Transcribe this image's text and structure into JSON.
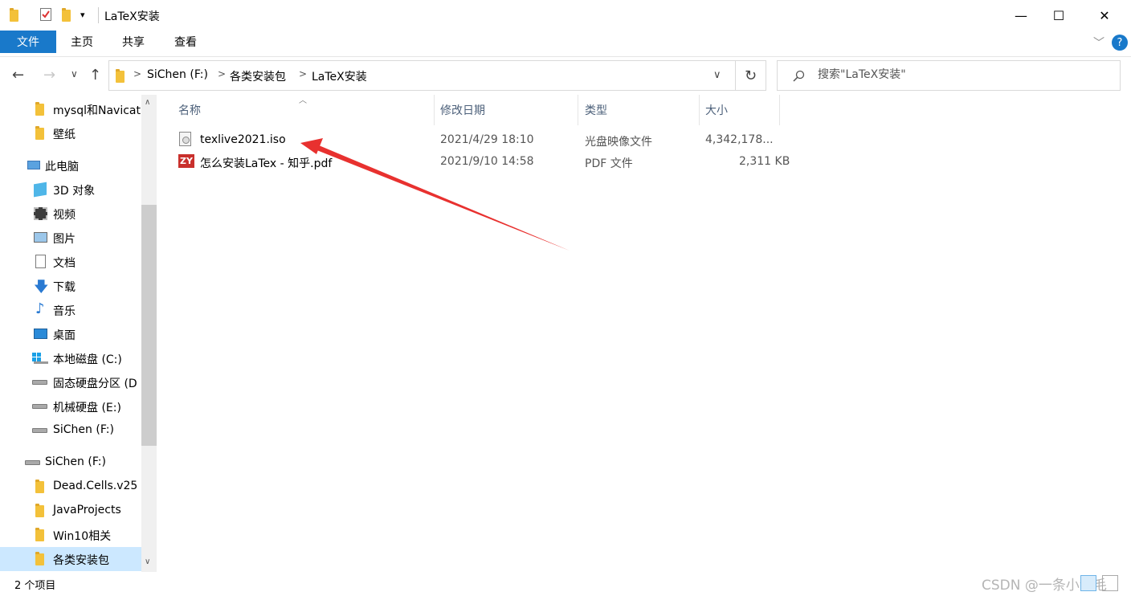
{
  "window": {
    "title": "LaTeX安装",
    "controls": {
      "minimize": "—",
      "maximize": "☐",
      "close": "✕"
    }
  },
  "ribbon": {
    "tabs": [
      "文件",
      "主页",
      "共享",
      "查看"
    ],
    "help_icon": "?"
  },
  "address": {
    "path": [
      "SiChen (F:)",
      "各类安装包",
      "LaTeX安装"
    ]
  },
  "search": {
    "placeholder": "搜索\"LaTeX安装\""
  },
  "nav": {
    "quick_items": [
      {
        "label": "mysql和Navicat",
        "icon": "folder-icon"
      },
      {
        "label": "壁纸",
        "icon": "folder-icon"
      }
    ],
    "this_pc": {
      "label": "此电脑",
      "icon": "computer-icon"
    },
    "pc_items": [
      {
        "label": "3D 对象",
        "icon": "3d-objects-icon"
      },
      {
        "label": "视频",
        "icon": "video-icon"
      },
      {
        "label": "图片",
        "icon": "picture-icon"
      },
      {
        "label": "文档",
        "icon": "document-icon"
      },
      {
        "label": "下载",
        "icon": "download-icon"
      },
      {
        "label": "音乐",
        "icon": "music-icon"
      },
      {
        "label": "桌面",
        "icon": "desktop-icon"
      },
      {
        "label": "本地磁盘 (C:)",
        "icon": "windows-drive-icon"
      },
      {
        "label": "固态硬盘分区 (D",
        "icon": "drive-icon"
      },
      {
        "label": "机械硬盘 (E:)",
        "icon": "drive-icon"
      },
      {
        "label": "SiChen (F:)",
        "icon": "drive-icon"
      }
    ],
    "drive": {
      "label": "SiChen (F:)",
      "icon": "drive-icon"
    },
    "drive_items": [
      {
        "label": "Dead.Cells.v25",
        "icon": "folder-icon"
      },
      {
        "label": "JavaProjects",
        "icon": "folder-icon"
      },
      {
        "label": "Win10相关",
        "icon": "folder-icon"
      },
      {
        "label": "各类安装包",
        "icon": "folder-icon",
        "selected": true
      }
    ]
  },
  "columns": {
    "name": "名称",
    "date": "修改日期",
    "type": "类型",
    "size": "大小"
  },
  "files": [
    {
      "name": "texlive2021.iso",
      "date": "2021/4/29 18:10",
      "type": "光盘映像文件",
      "size": "4,342,178...",
      "icon": "disc-image-icon"
    },
    {
      "name": "怎么安装LaTex - 知乎.pdf",
      "date": "2021/9/10 14:58",
      "type": "PDF 文件",
      "size": "2,311 KB",
      "icon": "pdf-icon"
    }
  ],
  "status": {
    "count": "2 个项目"
  },
  "watermark": "CSDN @一条小金毛",
  "colors": {
    "accent": "#1979ca",
    "folder": "#f3c13a",
    "arrow": "#e8312f",
    "selected_bg": "#cce8ff"
  }
}
